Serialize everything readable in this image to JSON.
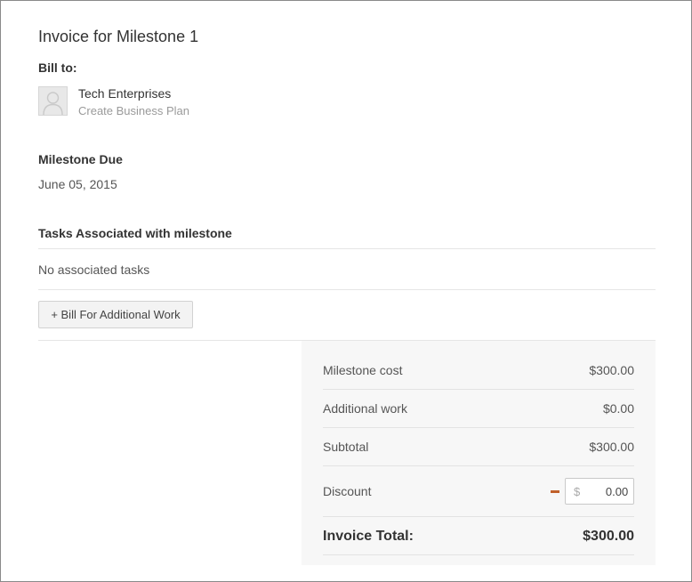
{
  "invoice": {
    "title": "Invoice for Milestone 1"
  },
  "bill_to": {
    "label": "Bill to:",
    "client_name": "Tech Enterprises",
    "project_name": "Create Business Plan",
    "avatar_icon": "user-silhouette-icon"
  },
  "milestone_due": {
    "label": "Milestone Due",
    "date": "June 05, 2015"
  },
  "tasks": {
    "label": "Tasks Associated with milestone",
    "empty_text": "No associated tasks"
  },
  "actions": {
    "bill_additional_label": "+ Bill For Additional Work"
  },
  "summary": {
    "milestone_cost_label": "Milestone cost",
    "milestone_cost_value": "$300.00",
    "additional_work_label": "Additional work",
    "additional_work_value": "$0.00",
    "subtotal_label": "Subtotal",
    "subtotal_value": "$300.00",
    "discount_label": "Discount",
    "discount_currency": "$",
    "discount_value": "0.00",
    "total_label": "Invoice Total:",
    "total_value": "$300.00"
  },
  "colors": {
    "minus_accent": "#c0602a",
    "summary_bg": "#f7f7f7"
  }
}
